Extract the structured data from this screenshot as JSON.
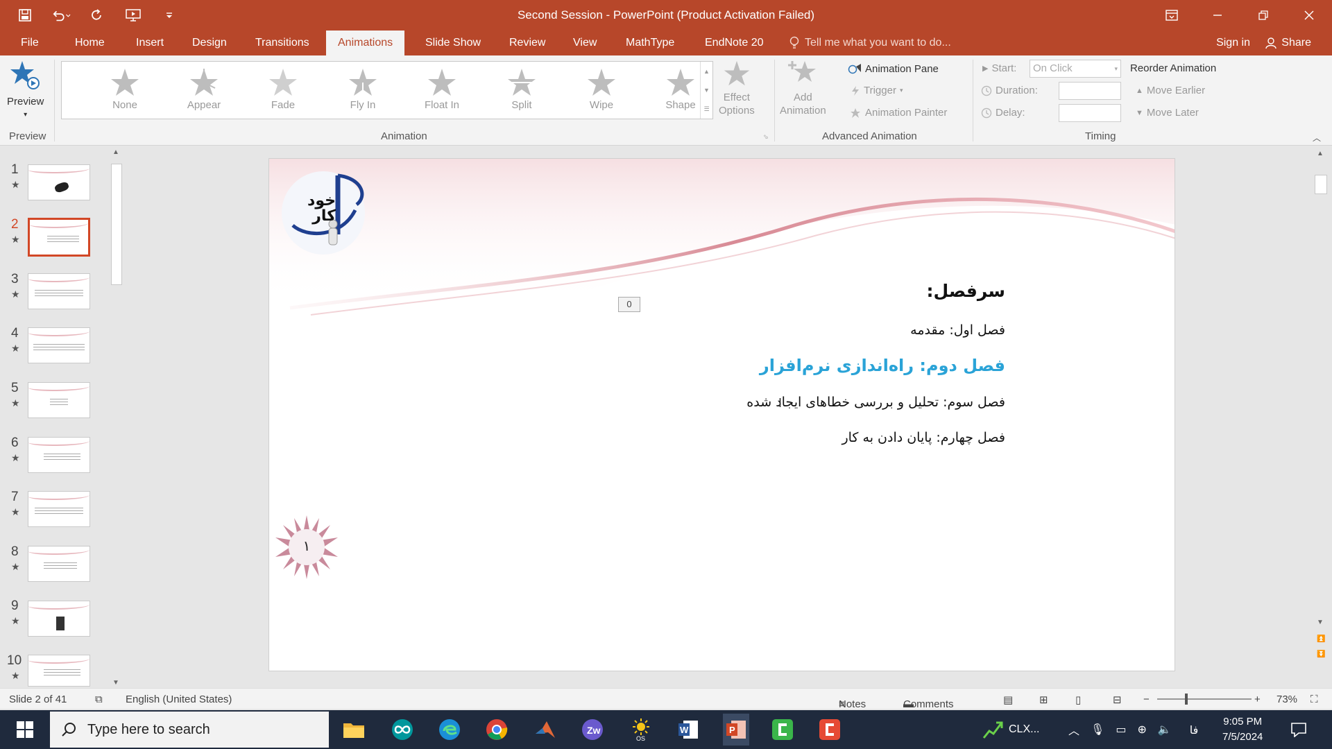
{
  "window": {
    "title": "Second Session - PowerPoint (Product Activation Failed)"
  },
  "tabs": [
    {
      "label": "File"
    },
    {
      "label": "Home"
    },
    {
      "label": "Insert"
    },
    {
      "label": "Design"
    },
    {
      "label": "Transitions"
    },
    {
      "label": "Animations"
    },
    {
      "label": "Slide Show"
    },
    {
      "label": "Review"
    },
    {
      "label": "View"
    },
    {
      "label": "MathType"
    },
    {
      "label": "EndNote 20"
    }
  ],
  "tell_me": "Tell me what you want to do...",
  "sign_in": "Sign in",
  "share": "Share",
  "ribbon": {
    "preview": {
      "button": "Preview",
      "group": "Preview"
    },
    "animation": {
      "group": "Animation",
      "effects": [
        "None",
        "Appear",
        "Fade",
        "Fly In",
        "Float In",
        "Split",
        "Wipe",
        "Shape"
      ],
      "effect_options_1": "Effect",
      "effect_options_2": "Options"
    },
    "advanced": {
      "group": "Advanced Animation",
      "add_1": "Add",
      "add_2": "Animation",
      "pane": "Animation Pane",
      "trigger": "Trigger",
      "painter": "Animation Painter"
    },
    "timing": {
      "group": "Timing",
      "start_label": "Start:",
      "start_value": "On Click",
      "duration_label": "Duration:",
      "delay_label": "Delay:",
      "reorder": "Reorder Animation",
      "earlier": "Move Earlier",
      "later": "Move Later"
    }
  },
  "thumbnails": [
    {
      "num": "1"
    },
    {
      "num": "2"
    },
    {
      "num": "3"
    },
    {
      "num": "4"
    },
    {
      "num": "5"
    },
    {
      "num": "6"
    },
    {
      "num": "7"
    },
    {
      "num": "8"
    },
    {
      "num": "9"
    },
    {
      "num": "10"
    }
  ],
  "slide": {
    "logo_text": "خود کار",
    "anim_tag": "0",
    "heading": "سرفصل:",
    "item1": "فصل اول: مقدمه",
    "item2": "فصل دوم: راه‌اندازی نرم‌افزار",
    "item3": "فصل سوم: تحلیل و بررسی خطاهای ایجاد شده",
    "item4": "فصل چهارم: پایان دادن به کار",
    "page_badge": "۱",
    "highlight_color": "#2aa3d7"
  },
  "status": {
    "slide": "Slide 2 of 41",
    "language": "English (United States)",
    "notes": "Notes",
    "comments": "Comments",
    "zoom": "73%"
  },
  "taskbar": {
    "search_placeholder": "Type here to search",
    "tray_app": "CLX...",
    "lang": "فا",
    "time": "9:05 PM",
    "date": "7/5/2024"
  }
}
